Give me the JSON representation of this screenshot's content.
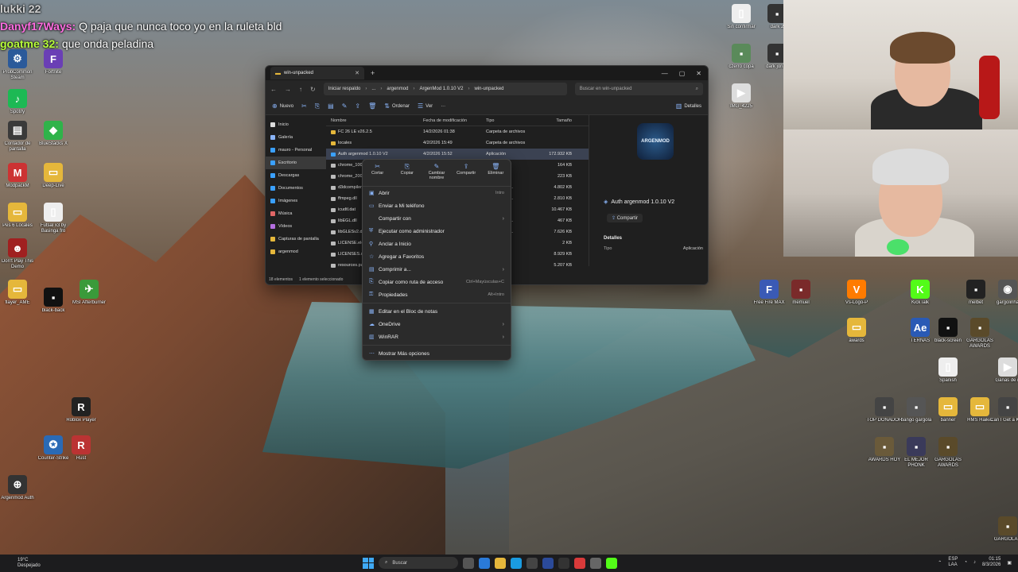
{
  "chat": [
    {
      "user": "lukki 22",
      "text": "",
      "style": "grey"
    },
    {
      "user": "Danyf17Ways:",
      "text": "Q paja que nunca toco yo en la ruleta bld",
      "style": "alt"
    },
    {
      "user": "goatme 32:",
      "text": "que onda peladina",
      "style": "main"
    }
  ],
  "desktop_icons": [
    {
      "label": "ProbCommon Steam",
      "color": "#2b5a9a",
      "glyph": "⚙"
    },
    {
      "label": "Fortnite",
      "color": "#6a3fb5",
      "glyph": "F"
    },
    {
      "label": "Spotify",
      "color": "#1db954",
      "glyph": "♪"
    },
    {
      "label": "Contador de pantalla",
      "color": "#3a3a3a",
      "glyph": "▤"
    },
    {
      "label": "BlueStacks X",
      "color": "#2fb34a",
      "glyph": "◆"
    },
    {
      "label": "ModpackM",
      "color": "#c33",
      "glyph": "M"
    },
    {
      "label": "Deep-Live",
      "color": "#e5b73b",
      "glyph": "▭"
    },
    {
      "label": "Pes 6 Locales",
      "color": "#e5b73b",
      "glyph": "▭"
    },
    {
      "label": "Futsal x3 by Basinga fro",
      "color": "#eee",
      "glyph": "▯"
    },
    {
      "label": "Don't Play This Demo",
      "color": "#a02020",
      "glyph": "☻"
    },
    {
      "label": "flayer_AME",
      "color": "#e5b73b",
      "glyph": "▭"
    },
    {
      "label": "black-back",
      "color": "#111",
      "glyph": "▪"
    },
    {
      "label": "MSI Afterburner",
      "color": "#3a9a3a",
      "glyph": "✈"
    },
    {
      "label": "Roblox Player",
      "color": "#222",
      "glyph": "R"
    },
    {
      "label": "Counter-Strike",
      "color": "#2a6ab5",
      "glyph": "✪"
    },
    {
      "label": "Rust",
      "color": "#b33",
      "glyph": "R"
    },
    {
      "label": "Argenmod Auth",
      "color": "#333",
      "glyph": "⊕"
    }
  ],
  "right_icons": [
    {
      "label": "Sin confirmar",
      "color": "#eee",
      "glyph": "▯"
    },
    {
      "label": "dark 2",
      "color": "#333",
      "glyph": "▪"
    },
    {
      "label": "czerro copa",
      "color": "#5a8a5a",
      "glyph": "▪"
    },
    {
      "label": "dark jonas",
      "color": "#333",
      "glyph": "▪"
    },
    {
      "label": "IMG_4225",
      "color": "#ddd",
      "glyph": "▶"
    },
    {
      "label": "Free Fire MAX",
      "color": "#3a5ab5",
      "glyph": "F"
    },
    {
      "label": "memuel",
      "color": "#7a2a2a",
      "glyph": "▪"
    },
    {
      "label": "Vs-Logo-P",
      "color": "#ff7b00",
      "glyph": "V"
    },
    {
      "label": "KickTalk",
      "color": "#53fc18",
      "glyph": "K"
    },
    {
      "label": "melbet",
      "color": "#222",
      "glyph": "▪"
    },
    {
      "label": "gargolinha",
      "color": "#555",
      "glyph": "◉"
    },
    {
      "label": "awards",
      "color": "#e5b73b",
      "glyph": "▭"
    },
    {
      "label": "TERNAS",
      "color": "#2a5ab5",
      "glyph": "Ae"
    },
    {
      "label": "black-screen",
      "color": "#111",
      "glyph": "▪"
    },
    {
      "label": "GARGOLAS AWARDS",
      "color": "#5a4a2a",
      "glyph": "▪"
    },
    {
      "label": "Spanish",
      "color": "#eee",
      "glyph": "▯"
    },
    {
      "label": "Ganas de ir",
      "color": "#ddd",
      "glyph": "▶"
    },
    {
      "label": "TOP DONADOR",
      "color": "#444",
      "glyph": "▪"
    },
    {
      "label": "bango gargola",
      "color": "#555",
      "glyph": "▪"
    },
    {
      "label": "banner",
      "color": "#e5b73b",
      "glyph": "▭"
    },
    {
      "label": "HMS Haikel",
      "color": "#e5b73b",
      "glyph": "▭"
    },
    {
      "label": "Can I Get a Kiss",
      "color": "#444",
      "glyph": "▪"
    },
    {
      "label": "AWARDS HOY",
      "color": "#6a5a3a",
      "glyph": "▪"
    },
    {
      "label": "EL MEJOR PHONK",
      "color": "#3a3a5a",
      "glyph": "▪"
    },
    {
      "label": "GARGOLAS AWARDS",
      "color": "#5a4a2a",
      "glyph": "▪"
    },
    {
      "label": "GARGOLA 4",
      "color": "#5a4a2a",
      "glyph": "▪"
    }
  ],
  "explorer": {
    "tab_title": "win-unpacked",
    "path": [
      "Iniciar respaldo",
      "...",
      "argenmod",
      "ArgenMod 1.0.10 V2",
      "win-unpacked"
    ],
    "search_placeholder": "Buscar en win-unpacked",
    "toolbar": {
      "new": "Nuevo",
      "sort": "Ordenar",
      "view": "Ver",
      "more": "···",
      "details": "Detalles"
    },
    "nav": [
      {
        "label": "Inicio",
        "color": "#ddd"
      },
      {
        "label": "Galería",
        "color": "#8ab4f8"
      },
      {
        "label": "mauro - Personal",
        "color": "#3aa0ff"
      },
      {
        "label": "Escritorio",
        "color": "#3aa0ff",
        "selected": true
      },
      {
        "label": "Descargas",
        "color": "#3aa0ff"
      },
      {
        "label": "Documentos",
        "color": "#3aa0ff"
      },
      {
        "label": "Imágenes",
        "color": "#3aa0ff"
      },
      {
        "label": "Música",
        "color": "#e06666"
      },
      {
        "label": "Vídeos",
        "color": "#b46ee0"
      },
      {
        "label": "Capturas de pantalla",
        "color": "#e5b73b"
      },
      {
        "label": "argenmod",
        "color": "#e5b73b"
      }
    ],
    "columns": {
      "name": "Nombre",
      "date": "Fecha de modificación",
      "type": "Tipo",
      "size": "Tamaño"
    },
    "files": [
      {
        "name": "FC 26 LE v26.2.5",
        "date": "14/2/2026 01:38",
        "type": "Carpeta de archivos",
        "size": "",
        "kind": "folder"
      },
      {
        "name": "locales",
        "date": "4/2/2026 15:49",
        "type": "Carpeta de archivos",
        "size": "",
        "kind": "folder"
      },
      {
        "name": "Auth argenmod 1.0.10 V2",
        "date": "4/2/2026 15:52",
        "type": "Aplicación",
        "size": "172.932 KB",
        "kind": "app",
        "selected": true
      },
      {
        "name": "chrome_100_percent",
        "date": "",
        "type": "PAK",
        "size": "164 KB",
        "kind": "file"
      },
      {
        "name": "chrome_200_percent",
        "date": "",
        "type": "PAK",
        "size": "223 KB",
        "kind": "file"
      },
      {
        "name": "d3dcompiler_47",
        "date": "",
        "type": "ón de la apli...",
        "size": "4.802 KB",
        "kind": "file"
      },
      {
        "name": "ffmpeg.dll",
        "date": "",
        "type": "ón de la apli...",
        "size": "2.810 KB",
        "kind": "file"
      },
      {
        "name": "icudtl.dat",
        "date": "",
        "type": "DAT",
        "size": "10.467 KB",
        "kind": "file"
      },
      {
        "name": "libEGL.dll",
        "date": "",
        "type": "ón de la apli...",
        "size": "467 KB",
        "kind": "file"
      },
      {
        "name": "libGLESv2.dll",
        "date": "",
        "type": "ón de la apli...",
        "size": "7.626 KB",
        "kind": "file"
      },
      {
        "name": "LICENSE.electron",
        "date": "",
        "type": "",
        "size": "2 KB",
        "kind": "file"
      },
      {
        "name": "LICENSES.chromium",
        "date": "",
        "type": "ft Edge H...",
        "size": "8.929 KB",
        "kind": "file"
      },
      {
        "name": "resources.pak",
        "date": "",
        "type": "PAK",
        "size": "5.207 KB",
        "kind": "file"
      }
    ],
    "detail": {
      "logo_text": "ARGENMOD",
      "name": "Auth argenmod 1.0.10 V2",
      "share": "Compartir",
      "section": "Detalles",
      "type_label": "Tipo",
      "type_value": "Aplicación"
    },
    "status": {
      "count": "18 elementos",
      "selected": "1 elemento seleccionado"
    }
  },
  "context_menu": {
    "quick_actions": [
      "Cortar",
      "Copiar",
      "Cambiar nombre",
      "Compartir",
      "Eliminar"
    ],
    "items": [
      {
        "label": "Abrir",
        "shortcut": "Intro",
        "icon": "▣",
        "chevron": false
      },
      {
        "label": "Enviar a Mi teléfono",
        "shortcut": "",
        "icon": "▭",
        "chevron": false
      },
      {
        "label": "Compartir con",
        "shortcut": "",
        "icon": "",
        "chevron": true
      },
      {
        "label": "Ejecutar como administrador",
        "shortcut": "",
        "icon": "⛨",
        "chevron": false
      },
      {
        "label": "Anclar a Inicio",
        "shortcut": "",
        "icon": "⚲",
        "chevron": false
      },
      {
        "label": "Agregar a Favoritos",
        "shortcut": "",
        "icon": "☆",
        "chevron": false
      },
      {
        "label": "Comprimir a...",
        "shortcut": "",
        "icon": "▤",
        "chevron": true
      },
      {
        "label": "Copiar como ruta de acceso",
        "shortcut": "Ctrl+Mayúsculas+C",
        "icon": "⎘",
        "chevron": false
      },
      {
        "label": "Propiedades",
        "shortcut": "Alt+Intro",
        "icon": "⚿",
        "chevron": false
      },
      {
        "label": "Editar en el Bloc de notas",
        "shortcut": "",
        "icon": "▦",
        "chevron": false,
        "sep_before": true
      },
      {
        "label": "OneDrive",
        "shortcut": "",
        "icon": "☁",
        "chevron": true
      },
      {
        "label": "WinRAR",
        "shortcut": "",
        "icon": "▥",
        "chevron": true
      },
      {
        "label": "Mostrar Más opciones",
        "shortcut": "",
        "icon": "⋯",
        "chevron": false,
        "sep_before": true
      }
    ]
  },
  "taskbar": {
    "weather_temp": "19°C",
    "weather_desc": "Despejado",
    "search": "Buscar",
    "lang": "ESP",
    "lang2": "LAA",
    "time": "01:15",
    "date": "8/3/2026"
  },
  "colors": {
    "accent": "#8ab4f8",
    "selected_row": "#3b4252",
    "window_bg": "#1f1f1f",
    "menu_bg": "#2b2b2b"
  }
}
